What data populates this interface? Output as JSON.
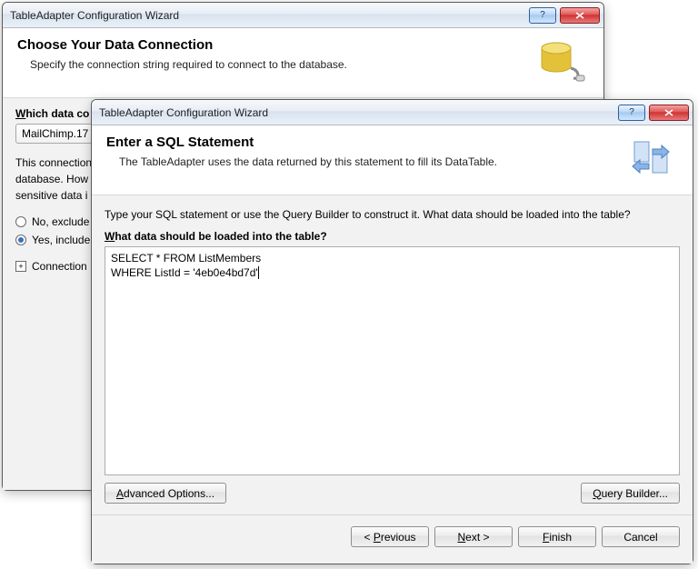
{
  "back": {
    "title": "TableAdapter Configuration Wizard",
    "header_title": "Choose Your Data Connection",
    "header_sub": "Specify the connection string required to connect to the database.",
    "which_label": "Which data co",
    "dropdown_value": "MailChimp.17",
    "body_text1": "This connection",
    "body_text2": "database. How",
    "body_text3": "sensitive data i",
    "radio_no": "No, exclude",
    "radio_yes": "Yes, include",
    "expand_label": "Connection"
  },
  "front": {
    "title": "TableAdapter Configuration Wizard",
    "header_title": "Enter a SQL Statement",
    "header_sub": "The TableAdapter uses the data returned by this statement to fill its DataTable.",
    "prompt": "Type your SQL statement or use the Query Builder to construct it. What data should be loaded into the table?",
    "field_label": "What data should be loaded into the table?",
    "sql_line1": "SELECT * FROM ListMembers",
    "sql_line2": "WHERE ListId = '4eb0e4bd7d'",
    "adv_btn": "Advanced Options...",
    "qb_btn": "Query Builder...",
    "prev_btn": "< Previous",
    "next_btn": "Next >",
    "finish_btn": "Finish",
    "cancel_btn": "Cancel"
  }
}
